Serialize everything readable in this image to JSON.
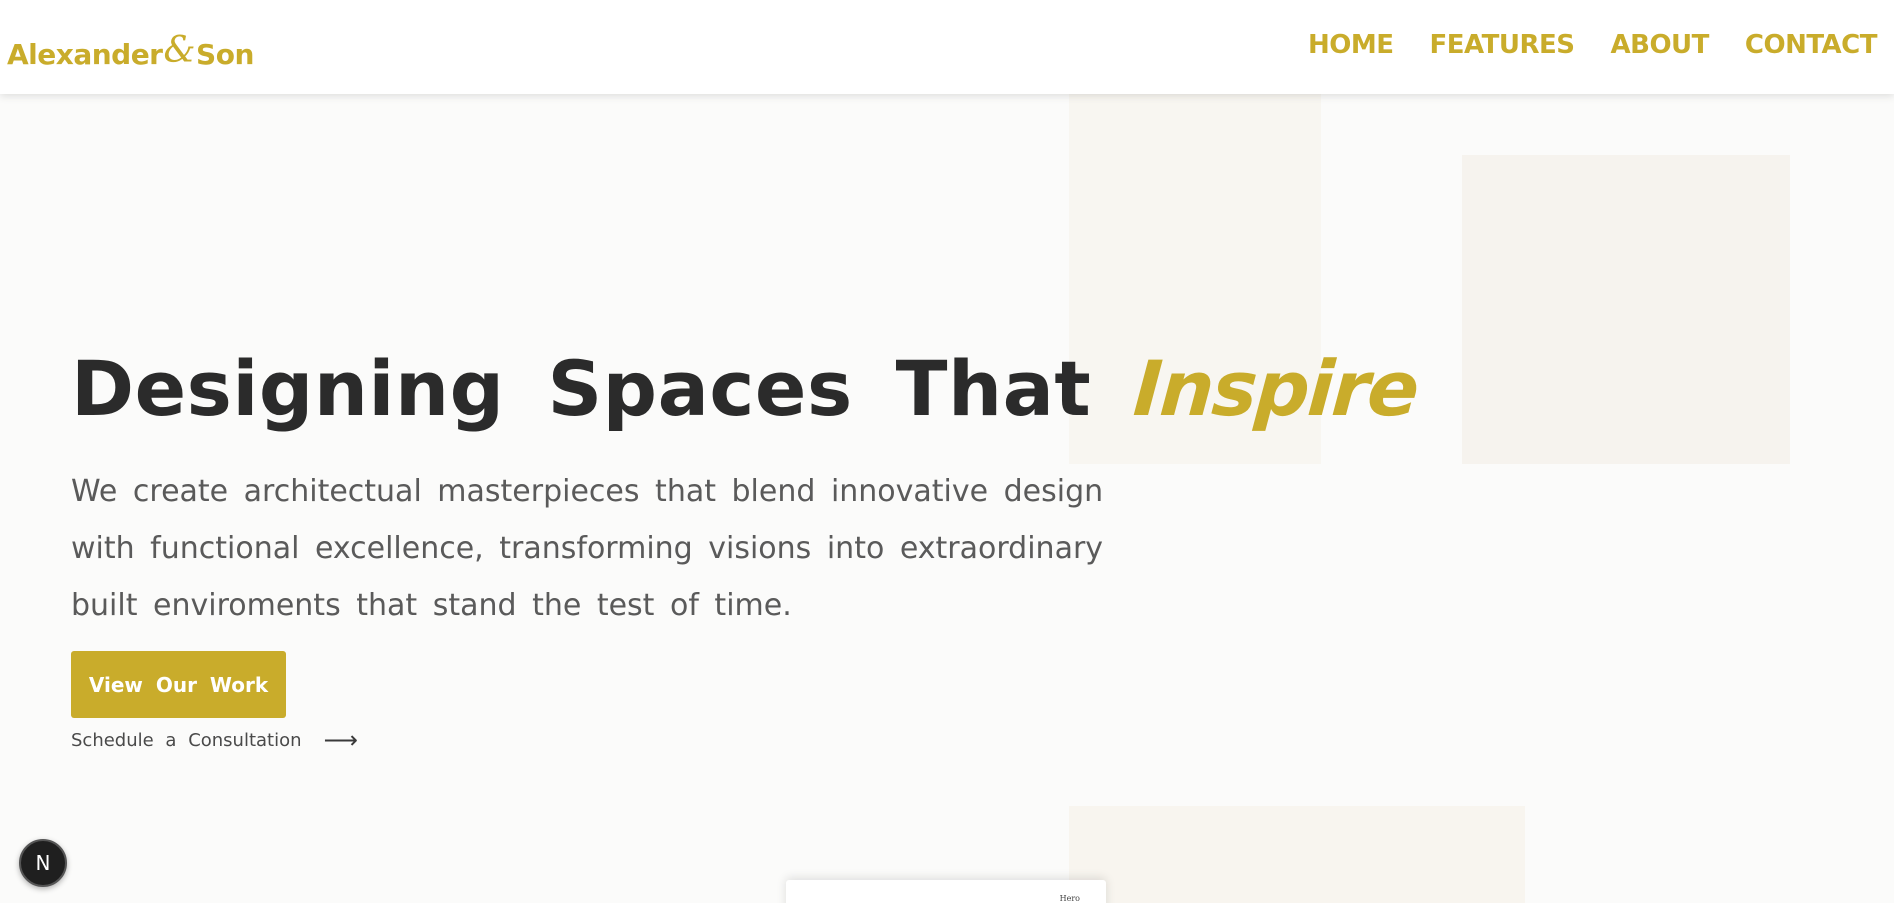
{
  "header": {
    "logo": {
      "first": "Alexander",
      "amp": "&",
      "last": "Son"
    },
    "nav": [
      {
        "label": "HOME"
      },
      {
        "label": "FEATURES"
      },
      {
        "label": "ABOUT"
      },
      {
        "label": "CONTACT"
      }
    ]
  },
  "hero": {
    "title_main": "Designing Spaces That",
    "title_accent": "Inspire",
    "description": "We create architectual masterpieces that blend innovative design with functional excellence, transforming visions into extraordinary built enviroments that stand the test of time.",
    "primary_button": "View Our Work",
    "secondary_link": "Schedule a Consultation",
    "secondary_icon": "arrow-right-icon",
    "secondary_glyph": "⟶"
  },
  "preview_card": {
    "label": "Hero"
  },
  "dev_badge": {
    "letter": "N",
    "icon": "nextjs-icon"
  },
  "colors": {
    "accent": "#c9ac2b",
    "text_dark": "#2b2b2b",
    "text_muted": "#5a5a5a",
    "background": "#fbfbfa"
  }
}
